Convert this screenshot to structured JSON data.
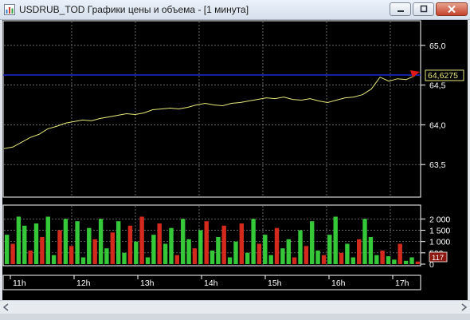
{
  "window": {
    "title": "USDRUB_TOD Графики цены и объема - [1 минута]",
    "icon": "chart-app-icon",
    "controls": [
      "minimize-icon",
      "maximize-icon",
      "close-icon"
    ]
  },
  "colors": {
    "background": "#000000",
    "grid": "#8c8c8c",
    "price_line": "#e8e87a",
    "last_price_line": "#1a2fd0",
    "last_price_marker": "#e01818",
    "last_price_text": "#e8e87a",
    "volume_up": "#35c93a",
    "volume_down": "#d42a1e",
    "volume_label_box": "#8a1810",
    "axis_text": "#ffffff",
    "panel_border": "#ffffff"
  },
  "price_axis": {
    "ticks": [
      "65,0",
      "64,5",
      "64,0",
      "63,5"
    ]
  },
  "volume_axis": {
    "ticks": [
      "2 000",
      "1 500",
      "1 000",
      "500",
      "0"
    ],
    "current_label": "117"
  },
  "time_axis": {
    "ticks": [
      "11h",
      "12h",
      "13h",
      "14h",
      "15h",
      "16h",
      "17h"
    ]
  },
  "last_price": "64,6275",
  "chart_data": {
    "type": "line",
    "series": [
      {
        "values": [
          63.7,
          63.72,
          63.78,
          63.84,
          63.88,
          63.95,
          63.98,
          64.02,
          64.04,
          64.06,
          64.05,
          64.08,
          64.1,
          64.12,
          64.14,
          64.13,
          64.15,
          64.19,
          64.2,
          64.21,
          64.2,
          64.22,
          64.25,
          64.27,
          64.25,
          64.24,
          64.27,
          64.28,
          64.3,
          64.32,
          64.34,
          64.33,
          64.35,
          64.32,
          64.31,
          64.33,
          64.3,
          64.28,
          64.31,
          64.34,
          64.35,
          64.38,
          64.45,
          64.6,
          64.55,
          64.58,
          64.57,
          64.62
        ]
      }
    ],
    "ylim": [
      63.1,
      65.3
    ],
    "volume": {
      "ylim": [
        0,
        2400
      ],
      "values": [
        1300,
        900,
        2100,
        1700,
        600,
        1800,
        1200,
        2100,
        400,
        1500,
        2000,
        800,
        1900,
        300,
        1600,
        1100,
        2000,
        700,
        1400,
        1900,
        500,
        1700,
        1000,
        2100,
        300,
        1300,
        1800,
        900,
        1600,
        400,
        2000,
        1100,
        700,
        1500,
        1900,
        600,
        1200,
        1700,
        300,
        1000,
        1800,
        500,
        2000,
        900,
        1300,
        400,
        1600,
        700,
        1100,
        300,
        1500,
        800,
        1900,
        600,
        400,
        1300,
        2100,
        500,
        900,
        300,
        1100,
        2000,
        1200,
        400,
        600,
        350,
        200,
        900,
        150,
        300,
        117
      ],
      "direction": [
        "u",
        "d",
        "u",
        "u",
        "d",
        "u",
        "d",
        "u",
        "u",
        "d",
        "u",
        "d",
        "u",
        "u",
        "u",
        "d",
        "u",
        "u",
        "d",
        "u",
        "u",
        "d",
        "u",
        "d",
        "u",
        "u",
        "d",
        "u",
        "u",
        "d",
        "u",
        "u",
        "d",
        "u",
        "d",
        "u",
        "u",
        "d",
        "u",
        "u",
        "d",
        "u",
        "u",
        "d",
        "u",
        "u",
        "d",
        "u",
        "u",
        "d",
        "u",
        "d",
        "u",
        "u",
        "d",
        "u",
        "u",
        "d",
        "u",
        "u",
        "d",
        "u",
        "u",
        "u",
        "d",
        "u",
        "u",
        "d",
        "u",
        "u",
        "d"
      ]
    }
  }
}
